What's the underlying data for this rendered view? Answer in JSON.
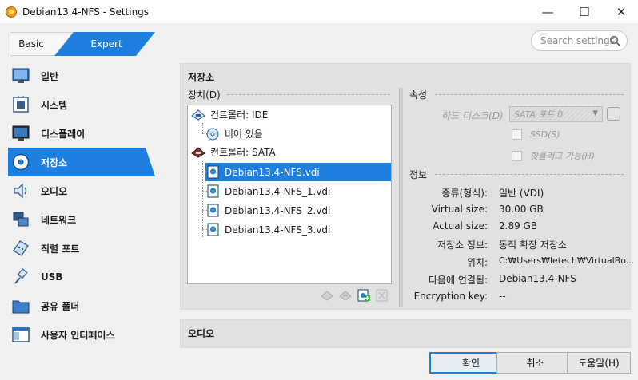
{
  "window": {
    "title": "Debian13.4-NFS - Settings",
    "minimize": "—",
    "maximize": "☐",
    "close": "✕"
  },
  "mode": {
    "basic": "Basic",
    "expert": "Expert"
  },
  "search": {
    "placeholder": "Search settings"
  },
  "sidebar": {
    "items": [
      {
        "label": "일반",
        "icon": "general-icon"
      },
      {
        "label": "시스템",
        "icon": "system-chip-icon"
      },
      {
        "label": "디스플레이",
        "icon": "display-monitor-icon"
      },
      {
        "label": "저장소",
        "icon": "storage-disk-icon",
        "active": true
      },
      {
        "label": "오디오",
        "icon": "audio-speaker-icon"
      },
      {
        "label": "네트워크",
        "icon": "network-icon"
      },
      {
        "label": "직렬 포트",
        "icon": "serial-port-icon"
      },
      {
        "label": "USB",
        "icon": "usb-plug-icon"
      },
      {
        "label": "공유 폴더",
        "icon": "shared-folder-icon"
      },
      {
        "label": "사용자 인터페이스",
        "icon": "user-interface-icon"
      }
    ]
  },
  "storage": {
    "section_title": "저장소",
    "devices_label": "장치(D)",
    "tree": [
      {
        "label": "컨트롤러: IDE",
        "type": "controller"
      },
      {
        "label": "비어 있음",
        "type": "optical"
      },
      {
        "label": "컨트롤러: SATA",
        "type": "controller"
      },
      {
        "label": "Debian13.4-NFS.vdi",
        "type": "disk",
        "selected": true
      },
      {
        "label": "Debian13.4-NFS_1.vdi",
        "type": "disk"
      },
      {
        "label": "Debian13.4-NFS_2.vdi",
        "type": "disk"
      },
      {
        "label": "Debian13.4-NFS_3.vdi",
        "type": "disk"
      }
    ],
    "attributes_label": "속성",
    "hard_disk_label": "하드 디스크(D)",
    "port_value": "SATA 포트 0",
    "ssd_label": "SSD(S)",
    "hotplug_label": "핫플러그 가능(H)",
    "info_label": "정보",
    "info": [
      {
        "key": "종류(형식):",
        "value": "일반 (VDI)"
      },
      {
        "key": "Virtual size:",
        "value": "30.00 GB"
      },
      {
        "key": "Actual size:",
        "value": "2.89 GB"
      },
      {
        "key": "저장소 정보:",
        "value": "동적 확장 저장소"
      },
      {
        "key": "위치:",
        "value": "C:₩Users₩letech₩VirtualBo..."
      },
      {
        "key": "다음에 연결됨:",
        "value": "Debian13.4-NFS"
      },
      {
        "key": "Encryption key:",
        "value": "--"
      }
    ]
  },
  "audio": {
    "section_title": "오디오"
  },
  "footer": {
    "ok": "확인",
    "cancel": "취소",
    "help": "도움말(H)"
  },
  "colors": {
    "accent": "#1e7fe0",
    "panel": "#e1e1e1",
    "background": "#f0f0f0"
  }
}
